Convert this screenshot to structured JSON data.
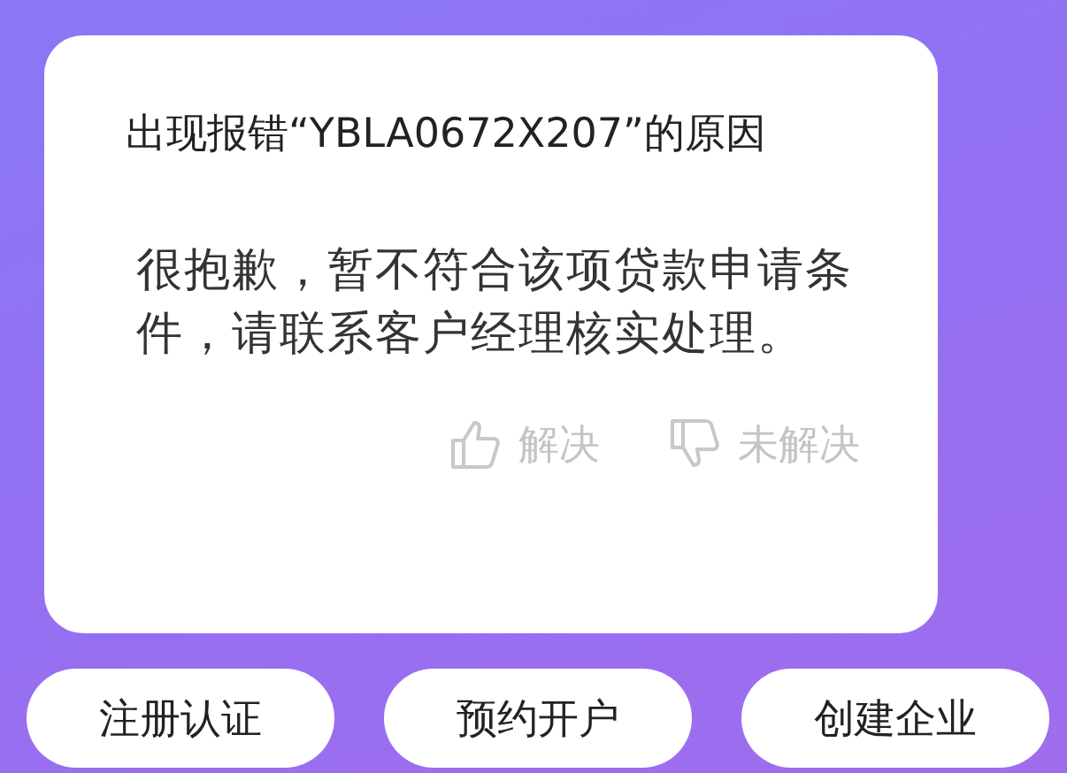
{
  "message": {
    "title": "出现报错“YBLA0672X207”的原因",
    "body": "很抱歉，暂不符合该项贷款申请条件，请联系客户经理核实处理。"
  },
  "feedback": [
    {
      "kind": "up",
      "label": "解决"
    },
    {
      "kind": "down",
      "label": "未解决"
    }
  ],
  "buttons": [
    "注册认证",
    "预约开户",
    "创建企业"
  ]
}
